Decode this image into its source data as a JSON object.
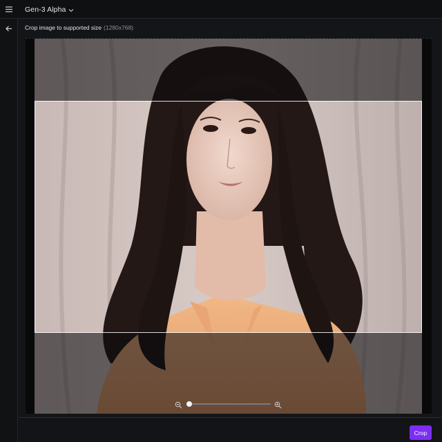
{
  "header": {
    "model_title": "Gen-3 Alpha",
    "menu_icon": "hamburger-menu-icon",
    "dropdown_icon": "chevron-down-icon"
  },
  "sidebar": {
    "back_icon": "arrow-left-icon"
  },
  "crop_panel": {
    "heading": "Crop image to supported size",
    "size_hint": "(1280x768)",
    "zoom": {
      "zoom_out_icon": "zoom-out-icon",
      "zoom_in_icon": "zoom-in-icon",
      "level_fraction": 0.0
    }
  },
  "footer": {
    "crop_label": "Crop"
  },
  "colors": {
    "accent": "#7b2ff2",
    "background": "#141518",
    "topbar": "#0f1012"
  }
}
